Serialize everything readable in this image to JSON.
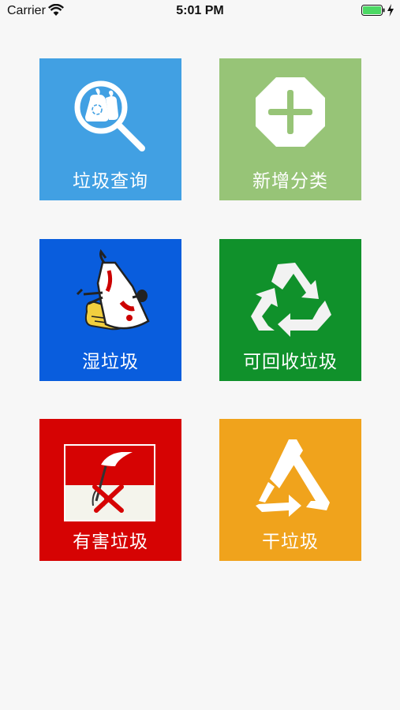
{
  "status_bar": {
    "carrier": "Carrier",
    "time": "5:01 PM",
    "battery_level": 1.0
  },
  "tiles": [
    {
      "label": "垃圾查询",
      "color": "#41a0e3",
      "icon": "search-bag-icon"
    },
    {
      "label": "新增分类",
      "color": "#97c477",
      "icon": "plus-octagon-icon"
    },
    {
      "label": "湿垃圾",
      "color": "#095ddd",
      "icon": "food-waste-icon"
    },
    {
      "label": "可回收垃圾",
      "color": "#10912b",
      "icon": "recycle-icon"
    },
    {
      "label": "有害垃圾",
      "color": "#d60303",
      "icon": "hazardous-flag-icon"
    },
    {
      "label": "干垃圾",
      "color": "#f0a31c",
      "icon": "residual-triangle-icon"
    }
  ]
}
